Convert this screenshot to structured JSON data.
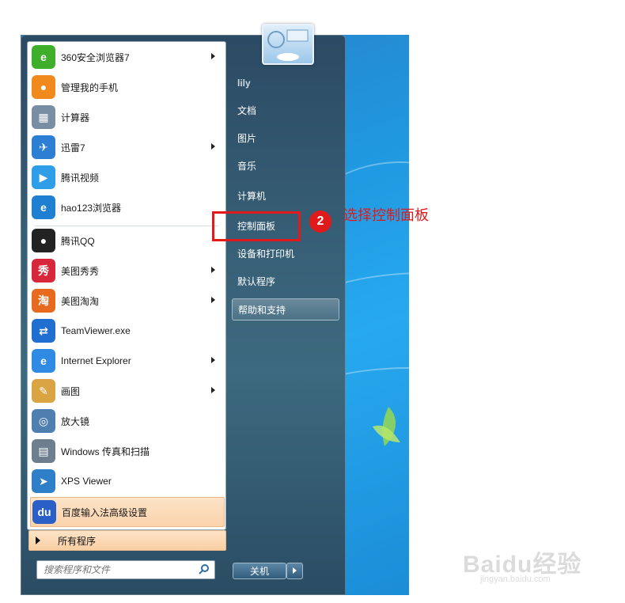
{
  "left_pane": {
    "items": [
      {
        "label": "360安全浏览器7",
        "icon": "browser-360-icon",
        "color": "#3fae2a",
        "glyph": "e",
        "submenu": true
      },
      {
        "label": "管理我的手机",
        "icon": "phone-manager-icon",
        "color": "#f08a1d",
        "glyph": "●",
        "submenu": false
      },
      {
        "label": "计算器",
        "icon": "calculator-icon",
        "color": "#7a8ea3",
        "glyph": "▦",
        "submenu": false
      },
      {
        "label": "迅雷7",
        "icon": "thunder-bird-icon",
        "color": "#2d7fd3",
        "glyph": "✈",
        "submenu": true
      },
      {
        "label": "腾讯视频",
        "icon": "tencent-video-icon",
        "color": "#2f9ee8",
        "glyph": "▶",
        "submenu": false
      },
      {
        "label": "hao123浏览器",
        "icon": "hao123-browser-icon",
        "color": "#1f7fd1",
        "glyph": "e",
        "submenu": false
      },
      {
        "label": "腾讯QQ",
        "icon": "qq-penguin-icon",
        "color": "#222222",
        "glyph": "●",
        "submenu": false
      },
      {
        "label": "美图秀秀",
        "icon": "meitu-xiuxiu-icon",
        "color": "#d6283a",
        "glyph": "秀",
        "submenu": true
      },
      {
        "label": "美图淘淘",
        "icon": "meitu-taotao-icon",
        "color": "#e86a1e",
        "glyph": "淘",
        "submenu": true
      },
      {
        "label": "TeamViewer.exe",
        "icon": "teamviewer-icon",
        "color": "#1e6fd0",
        "glyph": "⇄",
        "submenu": false
      },
      {
        "label": "Internet Explorer",
        "icon": "internet-explorer-icon",
        "color": "#2f8ae3",
        "glyph": "e",
        "submenu": true
      },
      {
        "label": "画图",
        "icon": "paint-palette-icon",
        "color": "#d9a441",
        "glyph": "✎",
        "submenu": true
      },
      {
        "label": "放大镜",
        "icon": "magnifier-icon",
        "color": "#4f7fb0",
        "glyph": "◎",
        "submenu": false
      },
      {
        "label": "Windows 传真和扫描",
        "icon": "fax-scan-icon",
        "color": "#6d7f8f",
        "glyph": "▤",
        "submenu": false
      },
      {
        "label": "XPS Viewer",
        "icon": "xps-viewer-icon",
        "color": "#2f7fc8",
        "glyph": "➤",
        "submenu": false
      },
      {
        "label": "百度输入法高级设置",
        "icon": "baidu-ime-icon",
        "color": "#2a5fc7",
        "glyph": "du",
        "submenu": false
      }
    ],
    "all_programs": "所有程序",
    "search_placeholder": "搜索程序和文件"
  },
  "right_pane": {
    "username": "lily",
    "items": [
      {
        "label": "文档"
      },
      {
        "label": "图片"
      },
      {
        "label": "音乐"
      },
      {
        "label": "计算机"
      },
      {
        "label": "控制面板"
      },
      {
        "label": "设备和打印机"
      },
      {
        "label": "默认程序"
      },
      {
        "label": "帮助和支持"
      }
    ],
    "shutdown_label": "关机"
  },
  "annotation": {
    "step": "2",
    "text": "选择控制面板",
    "color": "#e01a1a"
  },
  "watermark": {
    "main": "Baidu经验",
    "sub": "jingyan.baidu.com"
  }
}
